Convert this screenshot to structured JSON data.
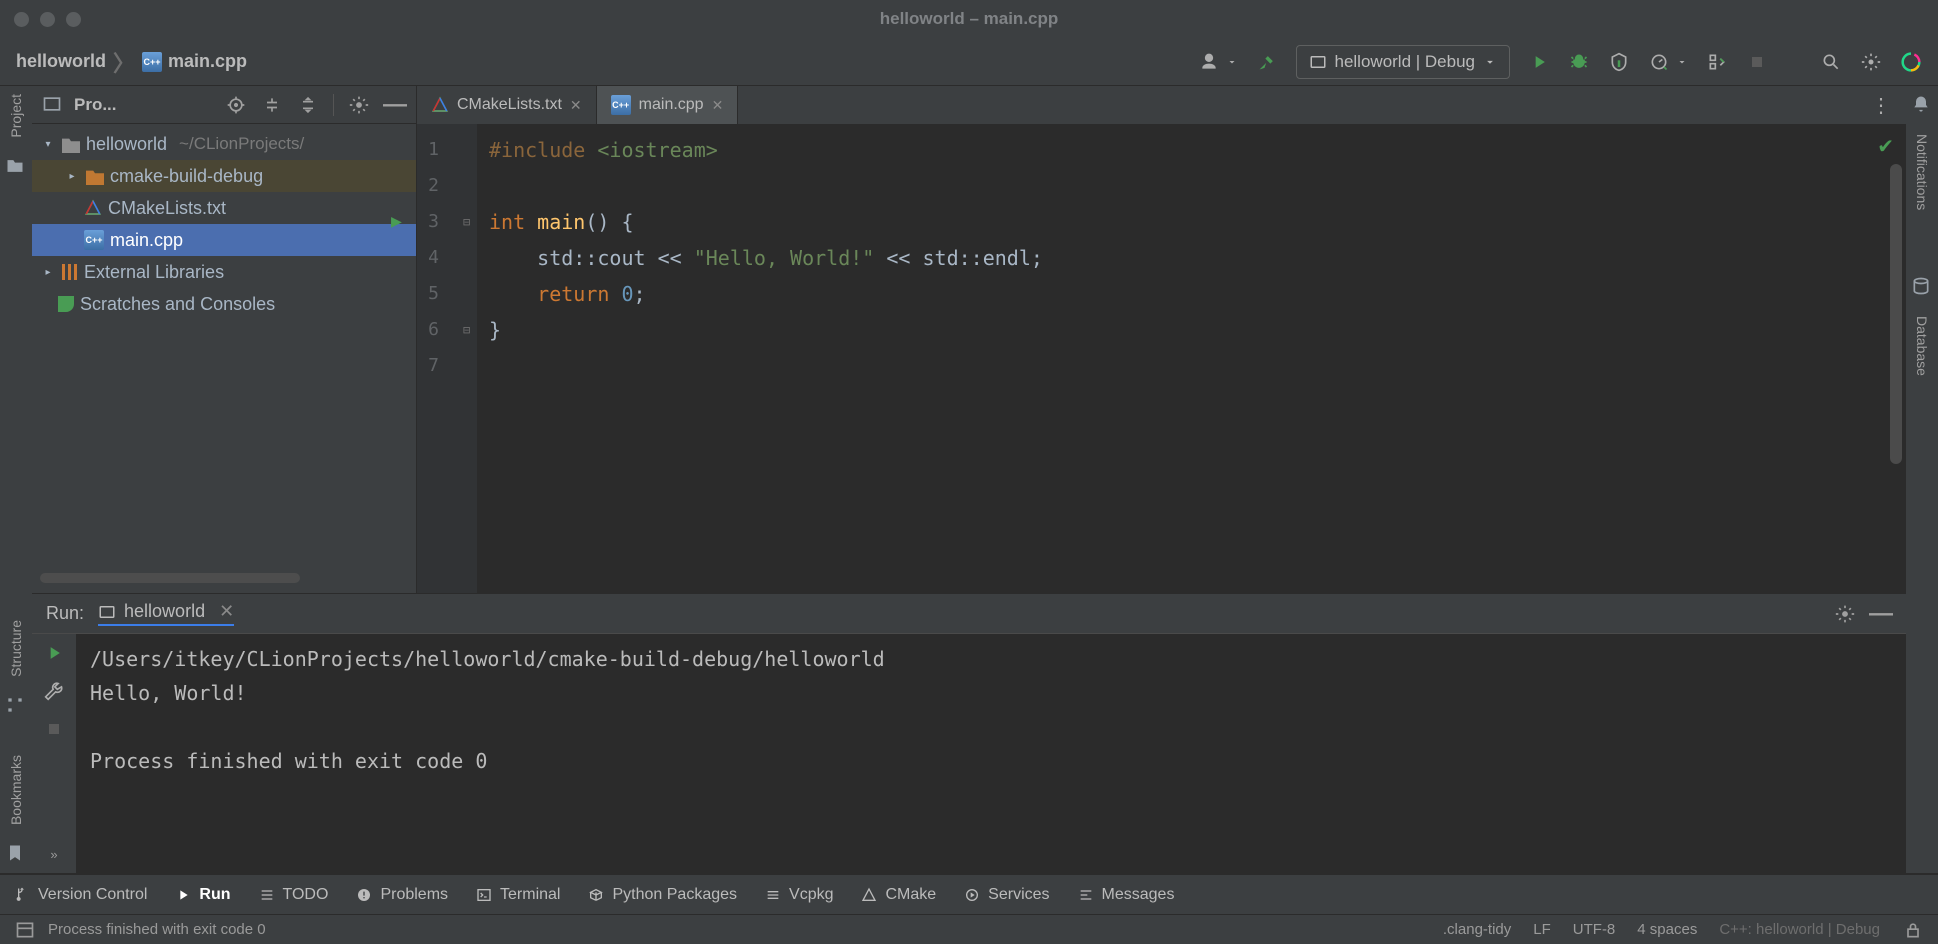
{
  "window": {
    "title": "helloworld – main.cpp"
  },
  "breadcrumb": {
    "root": "helloworld",
    "file": "main.cpp"
  },
  "toolbar": {
    "run_config": "helloworld | Debug"
  },
  "project": {
    "title": "Pro...",
    "root": {
      "name": "helloworld",
      "path": "~/CLionProjects/"
    },
    "children": {
      "build_dir": "cmake-build-debug",
      "cmake_file": "CMakeLists.txt",
      "main_file": "main.cpp"
    },
    "external": "External Libraries",
    "scratches": "Scratches and Consoles"
  },
  "tabs": [
    {
      "label": "CMakeLists.txt",
      "active": false
    },
    {
      "label": "main.cpp",
      "active": true
    }
  ],
  "editor": {
    "lines": [
      "1",
      "2",
      "3",
      "4",
      "5",
      "6",
      "7"
    ],
    "code": {
      "l1_a": "#include",
      "l1_b": "<iostream>",
      "l3_a": "int ",
      "l3_b": "main",
      "l3_c": "() {",
      "l4_a": "    std::cout << ",
      "l4_b": "\"Hello, World!\"",
      "l4_c": " << std::endl;",
      "l5_a": "    ",
      "l5_b": "return ",
      "l5_c": "0",
      "l5_d": ";",
      "l6": "}"
    }
  },
  "run": {
    "label": "Run:",
    "config": "helloworld",
    "output_path": "/Users/itkey/CLionProjects/helloworld/cmake-build-debug/helloworld",
    "output_line": "Hello, World!",
    "exit_line": "Process finished with exit code 0"
  },
  "bottom_tabs": {
    "vcs": "Version Control",
    "run": "Run",
    "todo": "TODO",
    "problems": "Problems",
    "terminal": "Terminal",
    "python": "Python Packages",
    "vcpkg": "Vcpkg",
    "cmake": "CMake",
    "services": "Services",
    "messages": "Messages"
  },
  "status": {
    "msg": "Process finished with exit code 0",
    "clang": ".clang-tidy",
    "eol": "LF",
    "enc": "UTF-8",
    "indent": "4 spaces",
    "ctx": "C++: helloworld | Debug"
  },
  "sidebars": {
    "project": "Project",
    "structure": "Structure",
    "bookmarks": "Bookmarks",
    "notifications": "Notifications",
    "database": "Database"
  }
}
